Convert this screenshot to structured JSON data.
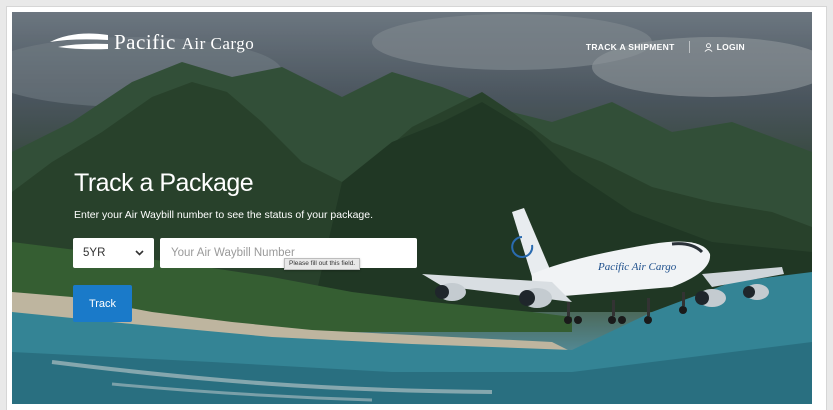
{
  "nav": {
    "brand_main": "Pacific",
    "brand_small": "Air Cargo",
    "track_link": "TRACK A SHIPMENT",
    "login_link": "LOGIN"
  },
  "hero": {
    "headline_light": "Track a",
    "headline_bold": "Package",
    "subtitle": "Enter your Air Waybill number to see the status of your package."
  },
  "form": {
    "prefix_selected": "5YR",
    "awb_placeholder": "Your Air Waybill Number",
    "awb_value": "",
    "validation_tooltip": "Please fill out this field.",
    "track_button": "Track"
  },
  "icons": {
    "logo": "swoosh-logo-icon",
    "login": "user-icon",
    "select": "chevron-down-icon"
  },
  "colors": {
    "accent": "#1a7ac9",
    "text_on_hero": "#ffffff"
  }
}
